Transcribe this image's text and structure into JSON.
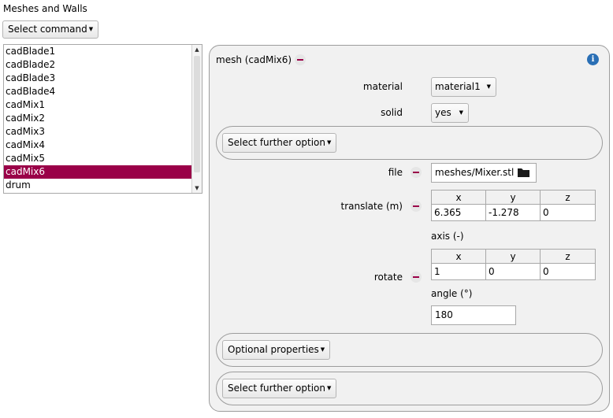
{
  "header": {
    "title": "Meshes and Walls",
    "select_command_label": "Select command"
  },
  "list": {
    "items": [
      "cadBlade1",
      "cadBlade2",
      "cadBlade3",
      "cadBlade4",
      "cadMix1",
      "cadMix2",
      "cadMix3",
      "cadMix4",
      "cadMix5",
      "cadMix6",
      "drum"
    ],
    "selected": "cadMix6"
  },
  "panel": {
    "title": "mesh (cadMix6)",
    "material_label": "material",
    "material_value": "material1",
    "solid_label": "solid",
    "solid_value": "yes",
    "further_option_label": "Select further option",
    "file_label": "file",
    "file_value": "meshes/Mixer.stl",
    "translate_label": "translate (m)",
    "translate": {
      "headers": [
        "x",
        "y",
        "z"
      ],
      "values": [
        "6.365",
        "-1.278",
        "0"
      ]
    },
    "rotate_label": "rotate",
    "axis_label": "axis (-)",
    "axis": {
      "headers": [
        "x",
        "y",
        "z"
      ],
      "values": [
        "1",
        "0",
        "0"
      ]
    },
    "angle_label": "angle (°)",
    "angle_value": "180",
    "optional_properties_label": "Optional properties",
    "further_option_label_2": "Select further option"
  },
  "icons": {
    "info": "info-icon",
    "folder": "folder-icon",
    "remove": "minus-icon"
  },
  "colors": {
    "selection": "#9a0048",
    "remove_icon": "#9a0048",
    "info_icon": "#2a6fb5",
    "panel_bg": "#f1f1f1"
  }
}
